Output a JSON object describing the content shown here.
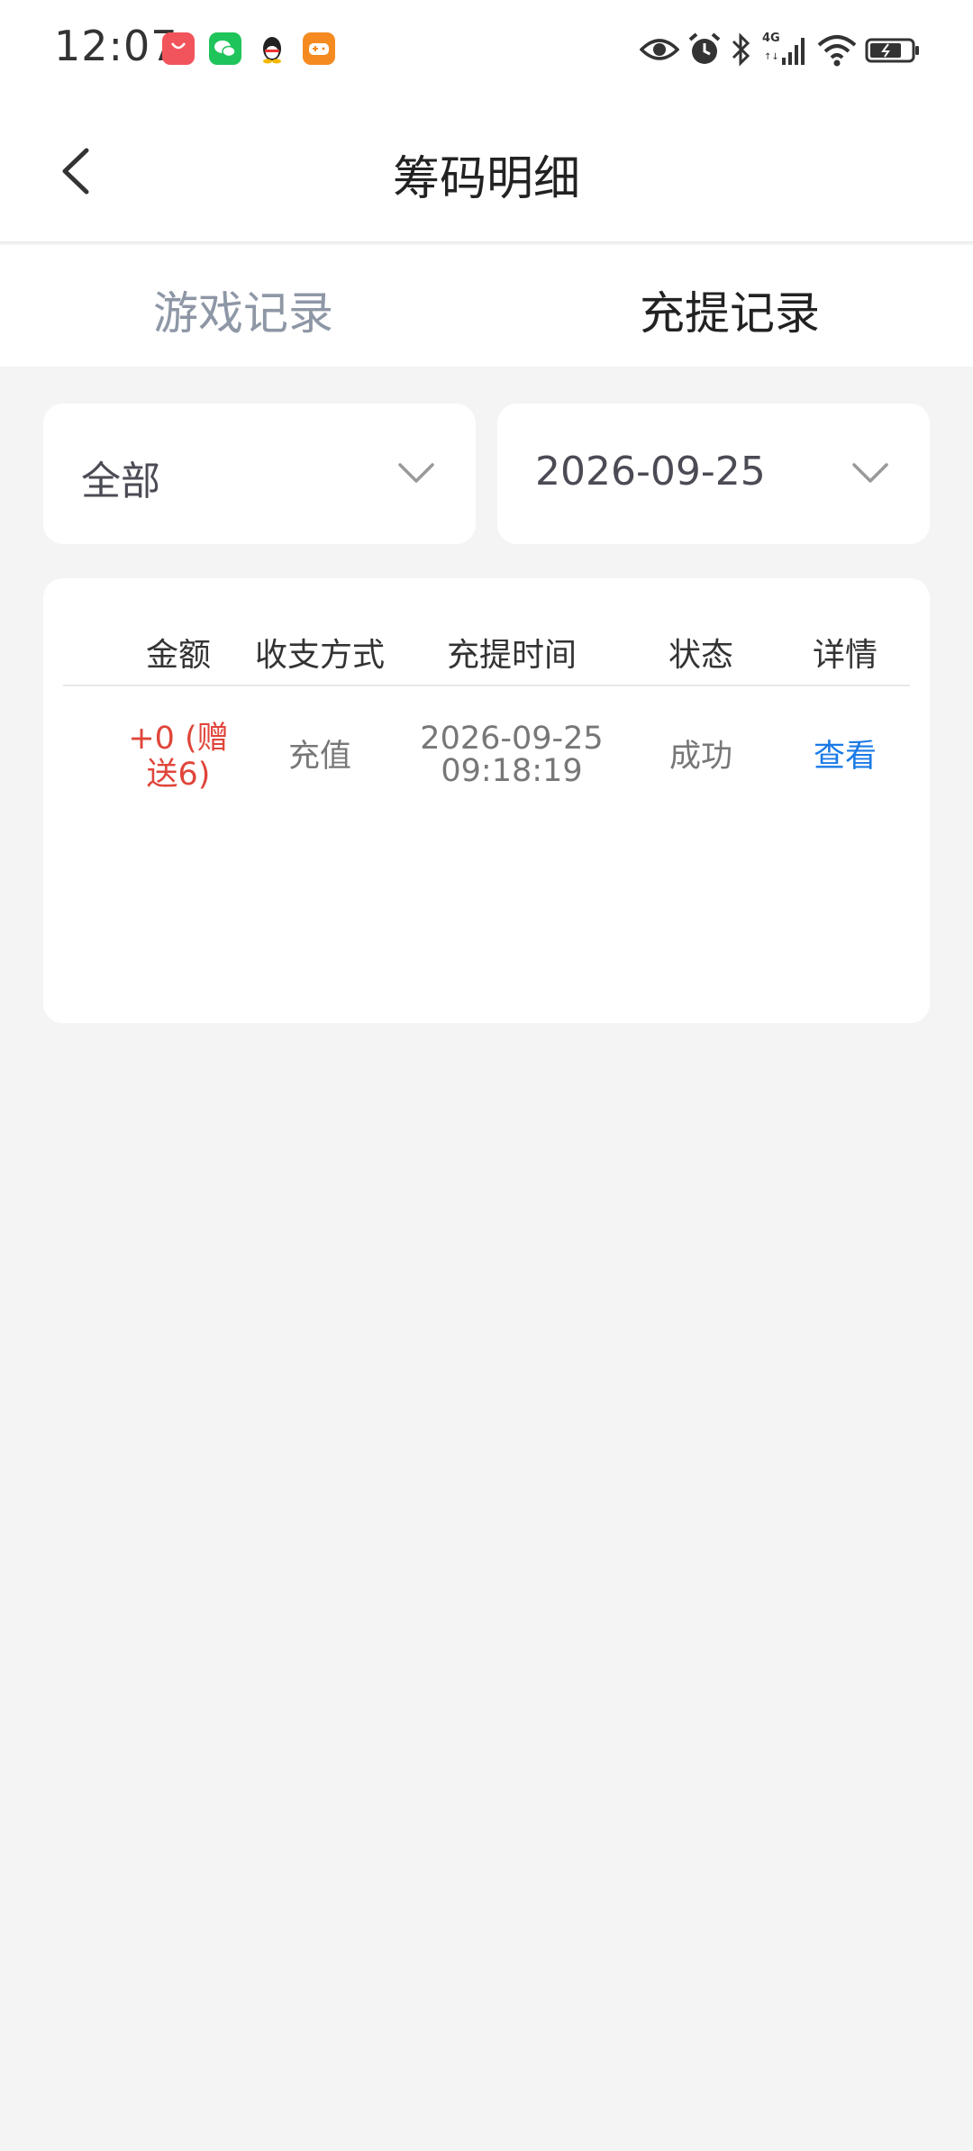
{
  "status_bar": {
    "time": "12:07",
    "app_icons": [
      "shopping-bag-icon",
      "wechat-icon",
      "qq-icon",
      "game-icon"
    ],
    "system_icons": [
      "eye-icon",
      "alarm-icon",
      "bluetooth-icon",
      "4g-signal-icon",
      "wifi-icon",
      "battery-icon"
    ]
  },
  "header": {
    "title": "筹码明细",
    "back_icon": "chevron-left-icon"
  },
  "tabs": [
    {
      "label": "游戏记录",
      "active": false
    },
    {
      "label": "充提记录",
      "active": true
    }
  ],
  "filters": {
    "type": {
      "value": "全部"
    },
    "date": {
      "value": "2026-09-25"
    }
  },
  "table": {
    "headers": [
      "金额",
      "收支方式",
      "充提时间",
      "状态",
      "详情"
    ],
    "rows": [
      {
        "amount_line1": "+0 (赠",
        "amount_line2": "送6)",
        "method": "充值",
        "time_date": "2026-09-25",
        "time_clock": "09:18:19",
        "status": "成功",
        "detail": "查看"
      }
    ]
  },
  "colors": {
    "accent_link": "#1a7ae6",
    "amount_red": "#e0453a",
    "inactive_tab": "#8e97a6",
    "background": "#f4f4f4"
  }
}
